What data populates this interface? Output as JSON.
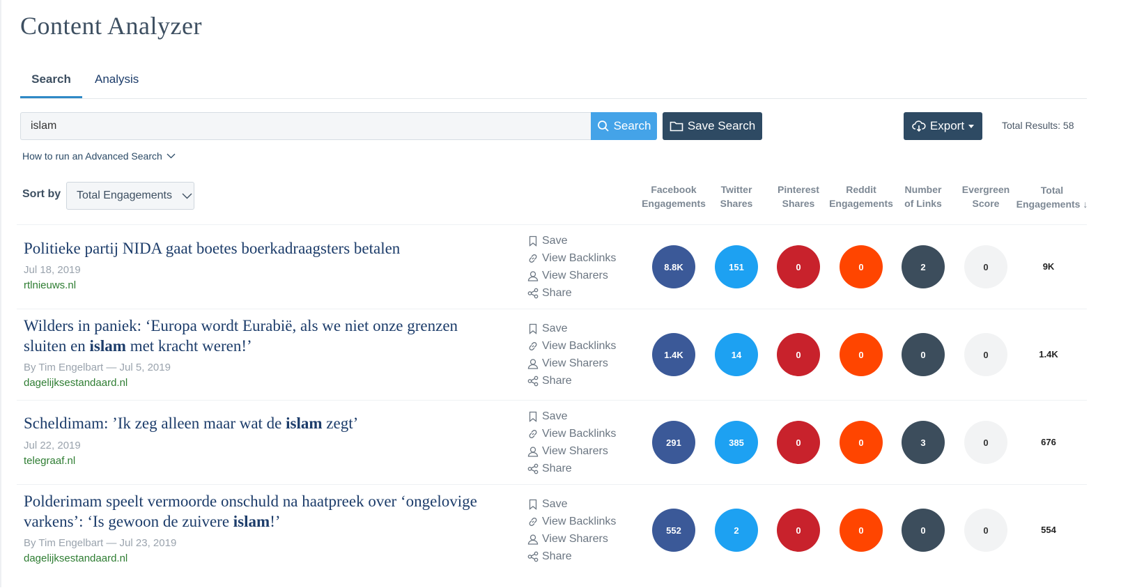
{
  "app": {
    "title": "Content Analyzer"
  },
  "tabs": [
    {
      "label": "Search",
      "active": true
    },
    {
      "label": "Analysis",
      "active": false
    }
  ],
  "search": {
    "value": "islam",
    "button_label": "Search",
    "save_label": "Save Search",
    "export_label": "Export",
    "total_results": "Total Results: 58",
    "advanced_link": "How to run an Advanced Search"
  },
  "sort": {
    "label": "Sort by",
    "selected": "Total Engagements"
  },
  "columns": [
    "Facebook\nEngagements",
    "Twitter\nShares",
    "Pinterest\nShares",
    "Reddit\nEngagements",
    "Number\nof Links",
    "Evergreen\nScore",
    "Total\nEngagements ↓"
  ],
  "actions": {
    "save": "Save",
    "backlinks": "View Backlinks",
    "sharers": "View Sharers",
    "share": "Share"
  },
  "colors": {
    "facebook": "#3b5998",
    "twitter": "#1da1f2",
    "pinterest": "#c8222c",
    "reddit": "#ff4500",
    "links": "#3c4d5c",
    "evergreen": "#f2f3f4",
    "primary_button": "#44a3e8",
    "dark_button": "#2e4a63",
    "domain_green": "#2e7d32"
  },
  "results": [
    {
      "title_parts": [
        {
          "text": "Politieke partij NIDA gaat boetes boerkadraagsters betalen",
          "bold": false
        }
      ],
      "meta": "Jul 18, 2019",
      "domain": "rtlnieuws.nl",
      "facebook": "8.8K",
      "twitter": "151",
      "pinterest": "0",
      "reddit": "0",
      "links": "2",
      "evergreen": "0",
      "total": "9K"
    },
    {
      "title_parts": [
        {
          "text": "Wilders in paniek: ‘Europa wordt Eurabië, als we niet onze grenzen sluiten en ",
          "bold": false
        },
        {
          "text": "islam",
          "bold": true
        },
        {
          "text": " met kracht weren!’",
          "bold": false
        }
      ],
      "meta": "By Tim Engelbart — Jul 5, 2019",
      "domain": "dagelijksestandaard.nl",
      "facebook": "1.4K",
      "twitter": "14",
      "pinterest": "0",
      "reddit": "0",
      "links": "0",
      "evergreen": "0",
      "total": "1.4K"
    },
    {
      "title_parts": [
        {
          "text": "Scheldimam: ’Ik zeg alleen maar wat de ",
          "bold": false
        },
        {
          "text": "islam",
          "bold": true
        },
        {
          "text": " zegt’",
          "bold": false
        }
      ],
      "meta": "Jul 22, 2019",
      "domain": "telegraaf.nl",
      "facebook": "291",
      "twitter": "385",
      "pinterest": "0",
      "reddit": "0",
      "links": "3",
      "evergreen": "0",
      "total": "676"
    },
    {
      "title_parts": [
        {
          "text": "Polderimam speelt vermoorde onschuld na haatpreek over ‘ongelovige varkens’: ‘Is gewoon de zuivere ",
          "bold": false
        },
        {
          "text": "islam",
          "bold": true
        },
        {
          "text": "!’",
          "bold": false
        }
      ],
      "meta": "By Tim Engelbart — Jul 23, 2019",
      "domain": "dagelijksestandaard.nl",
      "facebook": "552",
      "twitter": "2",
      "pinterest": "0",
      "reddit": "0",
      "links": "0",
      "evergreen": "0",
      "total": "554"
    }
  ]
}
